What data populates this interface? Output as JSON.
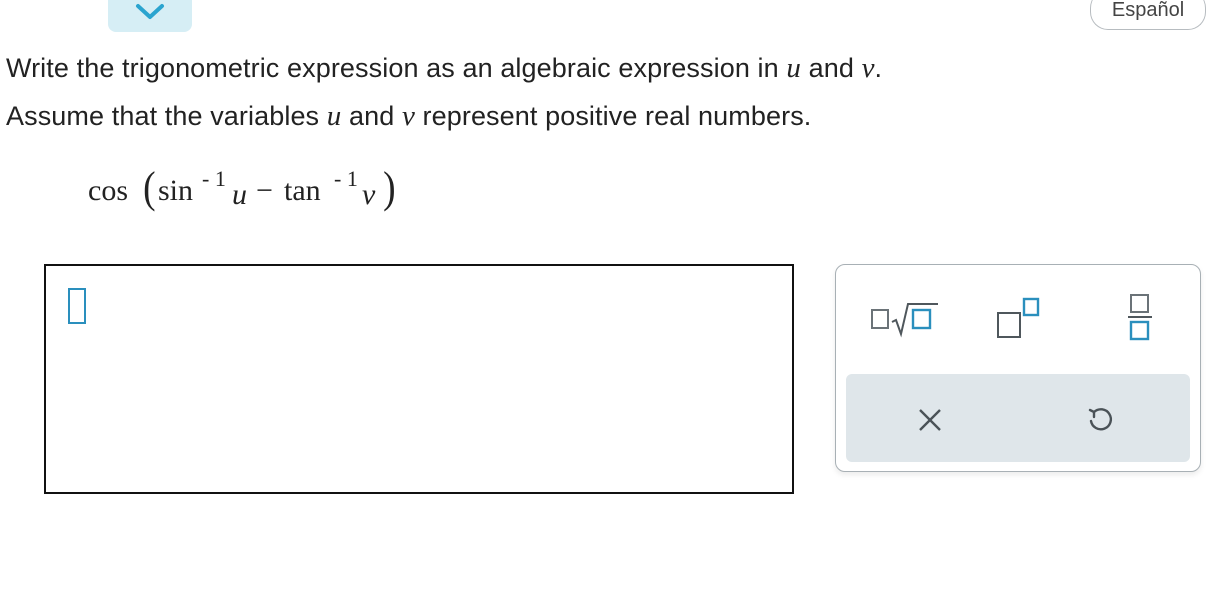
{
  "header": {
    "collapse_icon": "chevron-down-icon",
    "language_button": "Español"
  },
  "instructions": {
    "line1_prefix": "Write the trigonometric expression as an algebraic expression in ",
    "line1_var1": "u",
    "line1_mid": " and ",
    "line1_var2": "v",
    "line1_suffix": ".",
    "line2_prefix": "Assume that the variables ",
    "line2_var1": "u",
    "line2_mid": " and ",
    "line2_var2": "v",
    "line2_suffix": " represent positive real numbers."
  },
  "expression": {
    "cos": "cos",
    "open_paren": "(",
    "sin": "sin",
    "sin_exp": "- 1",
    "u": "u",
    "minus": "−",
    "tan": "tan",
    "tan_exp": "- 1",
    "v": "v",
    "close_paren": ")"
  },
  "answer": {
    "value": ""
  },
  "palette": {
    "tools": [
      "square-root-icon",
      "exponent-icon",
      "fraction-icon"
    ],
    "actions": [
      "clear-icon",
      "undo-icon"
    ],
    "accent": "#2a8fbd"
  }
}
